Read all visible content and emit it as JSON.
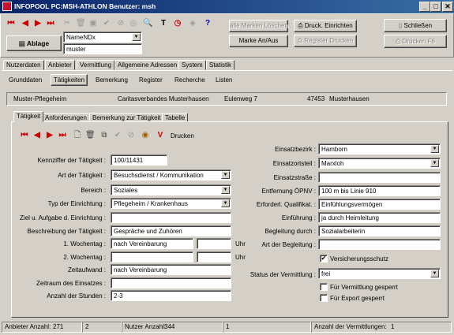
{
  "window": {
    "title": "INFOPOOL    PC:MSH-ATHLON  Benutzer: msh",
    "minimize": "_",
    "maximize": "□",
    "close": "✕"
  },
  "toolbar": {
    "ablage_label": "Ablage",
    "name_combo_value": "NameNDx",
    "search_value": "muster",
    "alle_marken_loeschen": "alle Marken Löschen",
    "marke_an_aus": "Marke An/Aus",
    "druck_einrichten": "Druck. Einrichten",
    "register_drucken": "Register Drucken",
    "schliessen": "Schließen",
    "drucken_f6": "Drucken F6",
    "t_icon_label": "T",
    "help_icon_label": "?"
  },
  "main_tabs": [
    "Nutzerdaten",
    "Anbieter",
    "Vermittlung",
    "Allgemeine Adressen",
    "System",
    "Statistik"
  ],
  "sub_tabs": [
    "Grunddaten",
    "Tätigkeiten",
    "Bemerkung",
    "Register",
    "Recherche",
    "Listen"
  ],
  "address_bar": {
    "name": "Muster-Pflegeheim",
    "org": "Caritasverbandes Musterhausen",
    "street": "Eulenweg 7",
    "zip": "47453",
    "city": "Musterhausen"
  },
  "inner_tabs": [
    "Tätigkeit",
    "Anforderungen",
    "Bemerkung zur Tätigkeit",
    "Tabelle"
  ],
  "inner_toolbar": {
    "drucken": "Drucken",
    "v_label": "V"
  },
  "form_left": {
    "kennziffer": {
      "label": "Kennziffer der Tätigkeit :",
      "value": "100/11431"
    },
    "art": {
      "label": "Art der Tätigkeit :",
      "value": "Besuchsdienst / Kommunikation"
    },
    "bereich": {
      "label": "Bereich :",
      "value": "Soziales"
    },
    "typ": {
      "label": "Typ der Einrichtung :",
      "value": "Pflegeheim / Krankenhaus"
    },
    "ziel": {
      "label": "Ziel u. Aufgabe d. Einrichtung :",
      "value": ""
    },
    "beschreibung": {
      "label": "Beschreibung der Tätigkeit :",
      "value": "Gespräche und Zuhören"
    },
    "wochentag1": {
      "label": "1. Wochentag :",
      "value": "nach Vereinbarung",
      "time": "",
      "uhr": "Uhr"
    },
    "wochentag2": {
      "label": "2. Wochentag :",
      "value": "",
      "time": "",
      "uhr": "Uhr"
    },
    "zeitaufwand": {
      "label": "Zeitaufwand :",
      "value": "nach Vereinbarung"
    },
    "zeitraum": {
      "label": "Zeitraum des Einsatzes :",
      "value": ""
    },
    "stunden": {
      "label": "Anzahl der Stunden :",
      "value": "2-3"
    }
  },
  "form_right": {
    "einsatzbezirk": {
      "label": "Einsatzbezirk :",
      "value": "Hamborn"
    },
    "einsatzortsteil": {
      "label": "Einsatzortsteil :",
      "value": "Marxloh"
    },
    "einsatzstrasse": {
      "label": "Einsatzstraße :",
      "value": ""
    },
    "entfernung": {
      "label": "Entfernung ÖPNV :",
      "value": "100 m bis Linie 910"
    },
    "qualifikation": {
      "label": "Erforderl. Qualifikat. :",
      "value": "Einfühlungsvermögen"
    },
    "einfuehrung": {
      "label": "Einführung :",
      "value": "ja durch Heimleitung"
    },
    "begleitung_durch": {
      "label": "Begleitung durch :",
      "value": "Sozialarbeiterin"
    },
    "art_begleitung": {
      "label": "Art der Begleitung :",
      "value": ""
    },
    "versicherungsschutz": {
      "label": "Versicherungsschutz",
      "checked": true
    },
    "status": {
      "label": "Status der Vermittlung :",
      "value": "frei"
    },
    "vermittlung_gesperrt": {
      "label": "Für Vermittlung gesperrt",
      "checked": false
    },
    "export_gesperrt": {
      "label": "Für Export gesperrt",
      "checked": false
    }
  },
  "statusbar": {
    "anbieter_label": "Anbieter Anzahl:",
    "anbieter_count": "271",
    "anbieter_pos": "2",
    "nutzer_label": "Nutzer Anzahl:",
    "nutzer_count": "344",
    "nutzer_pos": "1",
    "vermittlungen_label": "Anzahl der Vermittlungen:",
    "vermittlungen_count": "1"
  }
}
